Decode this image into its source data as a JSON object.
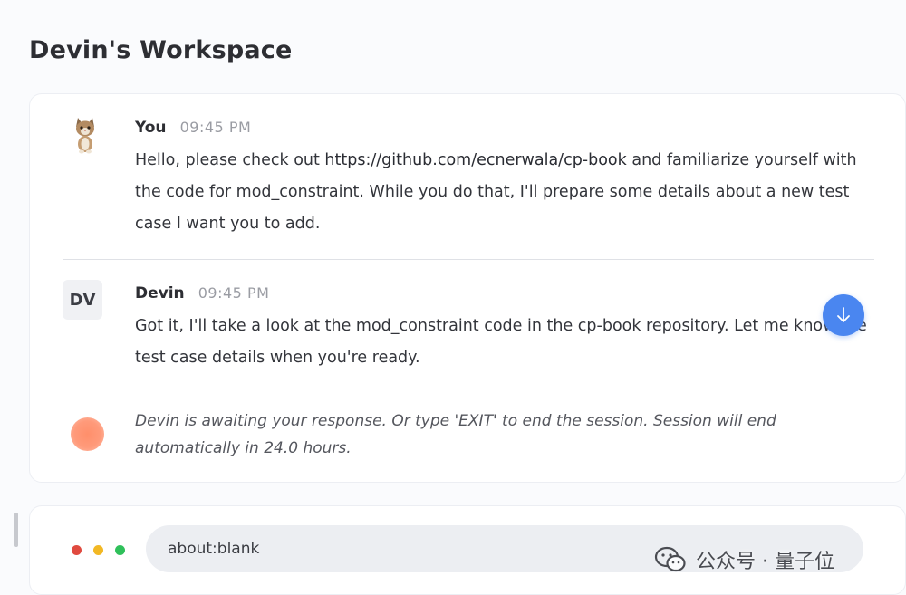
{
  "workspace": {
    "title": "Devin's Workspace"
  },
  "messages": [
    {
      "sender": "You",
      "time": "09:45 PM",
      "avatar_icon": "cat-avatar-icon",
      "text_before": "Hello, please check out ",
      "link": "https://github.com/ecnerwala/cp-book",
      "text_after": " and familiarize yourself with the code for mod_constraint. While you do that, I'll prepare some details about a new test case I want you to add."
    },
    {
      "sender": "Devin",
      "time": "09:45 PM",
      "avatar_initials": "DV",
      "text": "Got it, I'll take a look at the mod_constraint code in the cp-book repository. Let me know the test case details when you're ready."
    }
  ],
  "status": {
    "text": "Devin is awaiting your response. Or type 'EXIT' to end the session. Session will end automatically in 24.0 hours.",
    "indicator_color": "#ff8f6b"
  },
  "scroll_button": {
    "icon": "arrow-down-icon",
    "color": "#4a86f0"
  },
  "browser": {
    "url": "about:blank",
    "traffic_lights": [
      "#e04a3f",
      "#f2b824",
      "#2fc05a"
    ]
  },
  "watermark": {
    "icon": "wechat-icon",
    "text": "公众号 · 量子位"
  }
}
